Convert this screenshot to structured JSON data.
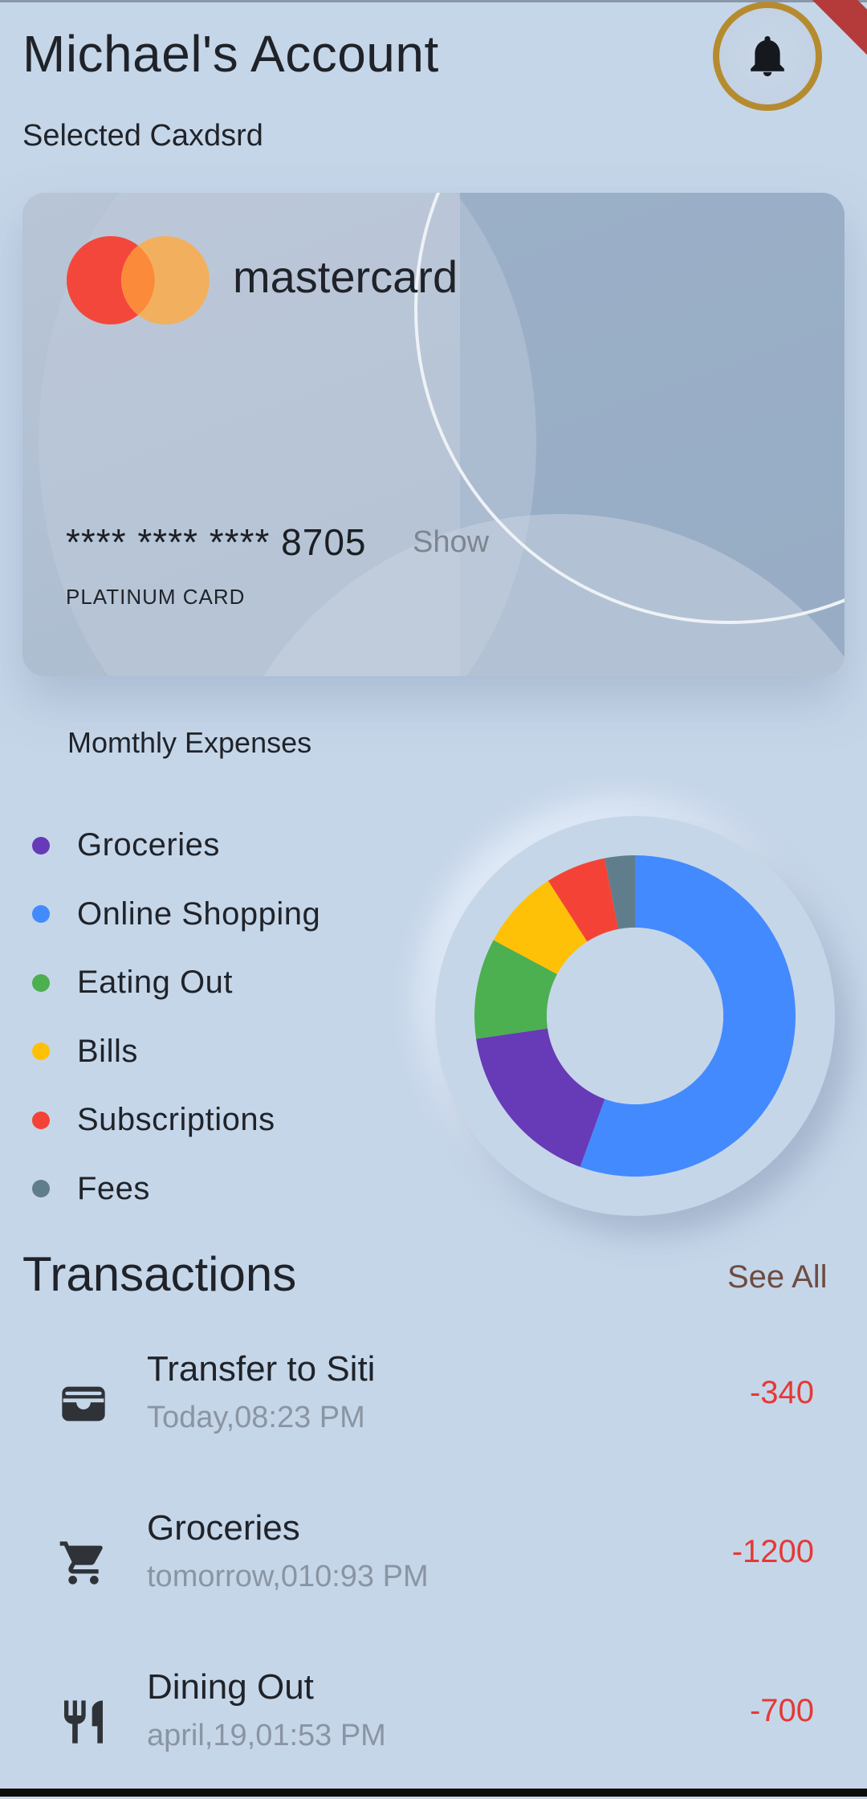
{
  "header": {
    "title": "Michael's Account",
    "subtitle": "Selected Caxdsrd"
  },
  "icons": {
    "bell": "bell-icon",
    "wallet": "wallet-icon",
    "cart": "cart-icon",
    "dining": "restaurant-icon"
  },
  "card": {
    "brand": "mastercard",
    "number": "**** **** **** 8705",
    "show_label": "Show",
    "type": "PLATINUM CARD"
  },
  "expenses": {
    "title": "Momthly Expenses",
    "categories": [
      {
        "label": "Groceries",
        "color": "#673ab7"
      },
      {
        "label": "Online Shopping",
        "color": "#448aff"
      },
      {
        "label": "Eating Out",
        "color": "#4caf50"
      },
      {
        "label": "Bills",
        "color": "#ffc107"
      },
      {
        "label": "Subscriptions",
        "color": "#f44336"
      },
      {
        "label": "Fees",
        "color": "#607d8b"
      }
    ]
  },
  "chart_data": {
    "type": "pie",
    "categories": [
      "Online Shopping",
      "Groceries",
      "Eating Out",
      "Bills",
      "Subscriptions",
      "Fees"
    ],
    "values": [
      55,
      17,
      10,
      8,
      6,
      3
    ],
    "colors": [
      "#448aff",
      "#673ab7",
      "#4caf50",
      "#ffc107",
      "#f44336",
      "#607d8b"
    ],
    "donut": true
  },
  "transactions": {
    "title": "Transactions",
    "see_all_label": "See All",
    "items": [
      {
        "name": "Transfer to Siti",
        "date": "Today,08:23 PM",
        "amount": "-340",
        "icon": "wallet-icon"
      },
      {
        "name": "Groceries",
        "date": "tomorrow,010:93 PM",
        "amount": "-1200",
        "icon": "cart-icon"
      },
      {
        "name": "Dining Out",
        "date": "april,19,01:53 PM",
        "amount": "-700",
        "icon": "restaurant-icon"
      }
    ]
  },
  "colors": {
    "background": "#c6d6e9",
    "accent_ring": "#b68b2f",
    "negative": "#e53935",
    "see_all": "#6d4c41"
  }
}
